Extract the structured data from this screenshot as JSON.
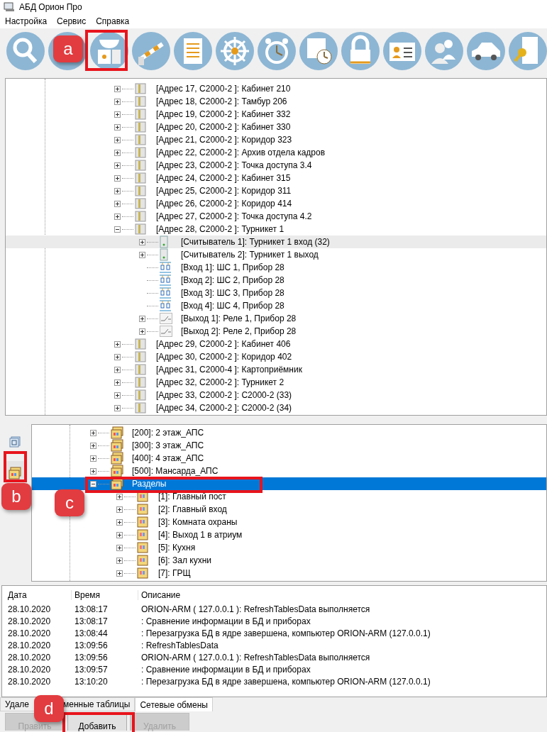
{
  "window": {
    "title": "АБД Орион Про"
  },
  "menu": [
    "Настройка",
    "Сервис",
    "Справка"
  ],
  "device_tree": {
    "focused": false,
    "items": [
      {
        "label": "[Адрес 17, С2000-2 ]: Кабинет 210",
        "kind": "device",
        "expanded": false,
        "selected": false
      },
      {
        "label": "[Адрес 18, С2000-2 ]: Тамбур 206",
        "kind": "device",
        "expanded": false,
        "selected": false
      },
      {
        "label": "[Адрес 19, С2000-2 ]: Кабинет 332",
        "kind": "device",
        "expanded": false,
        "selected": false
      },
      {
        "label": "[Адрес 20, С2000-2 ]: Кабинет 330",
        "kind": "device",
        "expanded": false,
        "selected": false
      },
      {
        "label": "[Адрес 21, С2000-2 ]: Коридор 323",
        "kind": "device",
        "expanded": false,
        "selected": false
      },
      {
        "label": "[Адрес 22, С2000-2 ]: Архив отдела кадров",
        "kind": "device",
        "expanded": false,
        "selected": false
      },
      {
        "label": "[Адрес 23, С2000-2 ]: Точка доступа 3.4",
        "kind": "device",
        "expanded": false,
        "selected": false
      },
      {
        "label": "[Адрес 24, С2000-2 ]: Кабинет 315",
        "kind": "device",
        "expanded": false,
        "selected": false
      },
      {
        "label": "[Адрес 25, С2000-2 ]: Коридор 311",
        "kind": "device",
        "expanded": false,
        "selected": false
      },
      {
        "label": "[Адрес 26, С2000-2 ]: Коридор 414",
        "kind": "device",
        "expanded": false,
        "selected": false
      },
      {
        "label": "[Адрес 27, С2000-2 ]: Точка доступа 4.2",
        "kind": "device",
        "expanded": false,
        "selected": false
      },
      {
        "label": "[Адрес 28, С2000-2 ]: Турникет 1",
        "kind": "device",
        "expanded": true,
        "selected": false,
        "children": [
          {
            "label": "[Считыватель 1]: Турникет 1 вход (32)",
            "kind": "reader",
            "expanded": false,
            "selected": true
          },
          {
            "label": "[Считыватель 2]: Турникет 1 выход",
            "kind": "reader",
            "expanded": false,
            "selected": false
          },
          {
            "label": "[Вход 1]: ШС 1, Прибор 28",
            "kind": "input",
            "selected": false
          },
          {
            "label": "[Вход 2]: ШС 2, Прибор 28",
            "kind": "input",
            "selected": false
          },
          {
            "label": "[Вход 3]: ШС 3, Прибор 28",
            "kind": "input",
            "selected": false
          },
          {
            "label": "[Вход 4]: ШС 4, Прибор 28",
            "kind": "input",
            "selected": false
          },
          {
            "label": "[Выход 1]: Реле 1, Прибор 28",
            "kind": "output",
            "expanded": false,
            "selected": false
          },
          {
            "label": "[Выход 2]: Реле 2, Прибор 28",
            "kind": "output",
            "expanded": false,
            "selected": false
          }
        ]
      },
      {
        "label": "[Адрес 29, С2000-2 ]: Кабинет 406",
        "kind": "device",
        "expanded": false,
        "selected": false
      },
      {
        "label": "[Адрес 30, С2000-2 ]: Коридор 402",
        "kind": "device",
        "expanded": false,
        "selected": false
      },
      {
        "label": "[Адрес 31, С2000-4 ]: Картоприёмник",
        "kind": "device",
        "expanded": false,
        "selected": false
      },
      {
        "label": "[Адрес 32, С2000-2 ]: Турникет 2",
        "kind": "device",
        "expanded": false,
        "selected": false
      },
      {
        "label": "[Адрес 33, С2000-2 ]: С2000-2 (33)",
        "kind": "device",
        "expanded": false,
        "selected": false
      },
      {
        "label": "[Адрес 34, С2000-2 ]: С2000-2 (34)",
        "kind": "device",
        "expanded": false,
        "selected": false
      }
    ]
  },
  "side_tabs": [
    {
      "selected": false
    },
    {
      "selected": true
    }
  ],
  "zone_tree": {
    "focused": true,
    "items": [
      {
        "label": "[200]: 2 этаж_АПС",
        "kind": "zone",
        "expanded": false,
        "selected": false
      },
      {
        "label": "[300]: 3 этаж_АПС",
        "kind": "zone",
        "expanded": false,
        "selected": false
      },
      {
        "label": "[400]: 4 этаж_АПС",
        "kind": "zone",
        "expanded": false,
        "selected": false
      },
      {
        "label": "[500]: Мансарда_АПС",
        "kind": "zone",
        "expanded": false,
        "selected": false
      },
      {
        "label": "Разделы",
        "kind": "zone",
        "expanded": true,
        "selected": true,
        "children": [
          {
            "label": "[1]: Главный пост",
            "kind": "section",
            "expanded": false,
            "selected": false
          },
          {
            "label": "[2]: Главный вход",
            "kind": "section",
            "expanded": false,
            "selected": false
          },
          {
            "label": "[3]: Комната охраны",
            "kind": "section",
            "expanded": false,
            "selected": false
          },
          {
            "label": "[4]: Выход 1 в атриум",
            "kind": "section",
            "expanded": false,
            "selected": false
          },
          {
            "label": "[5]: Кухня",
            "kind": "section",
            "expanded": false,
            "selected": false
          },
          {
            "label": "[6]: Зал кухни",
            "kind": "section",
            "expanded": false,
            "selected": false
          },
          {
            "label": "[7]: ГРЩ",
            "kind": "section",
            "expanded": false,
            "selected": false
          }
        ]
      }
    ]
  },
  "log": {
    "columns": [
      "Дата",
      "Время",
      "Описание"
    ],
    "rows": [
      [
        "28.10.2020",
        "13:08:17",
        "ORION-ARM ( 127.0.0.1 ): RefreshTablesData выполняется"
      ],
      [
        "28.10.2020",
        "13:08:17",
        ": Сравнение информации в БД и приборах"
      ],
      [
        "28.10.2020",
        "13:08:44",
        ": Перезагрузка БД в ядре завершена, компьютер ORION-ARM (127.0.0.1)"
      ],
      [
        "28.10.2020",
        "13:09:56",
        ": RefreshTablesData"
      ],
      [
        "28.10.2020",
        "13:09:56",
        "ORION-ARM ( 127.0.0.1 ): RefreshTablesData выполняется"
      ],
      [
        "28.10.2020",
        "13:09:57",
        ": Сравнение информации в БД и приборах"
      ],
      [
        "28.10.2020",
        "13:10:20",
        ": Перезагрузка БД в ядре завершена, компьютер ORION-ARM (127.0.0.1)"
      ]
    ]
  },
  "tabs": [
    {
      "label_parts": [
        "Удале",
        "менные таблицы"
      ],
      "selected": false
    },
    {
      "label_parts": [
        "Сетевые обмены"
      ],
      "selected": true
    }
  ],
  "buttons": [
    {
      "label": "Править",
      "disabled": true
    },
    {
      "label": "Добавить",
      "disabled": false
    },
    {
      "label": "Удалить",
      "disabled": true
    }
  ],
  "annotations": [
    {
      "label": "a"
    },
    {
      "label": "b"
    },
    {
      "label": "c"
    },
    {
      "label": "d"
    }
  ]
}
